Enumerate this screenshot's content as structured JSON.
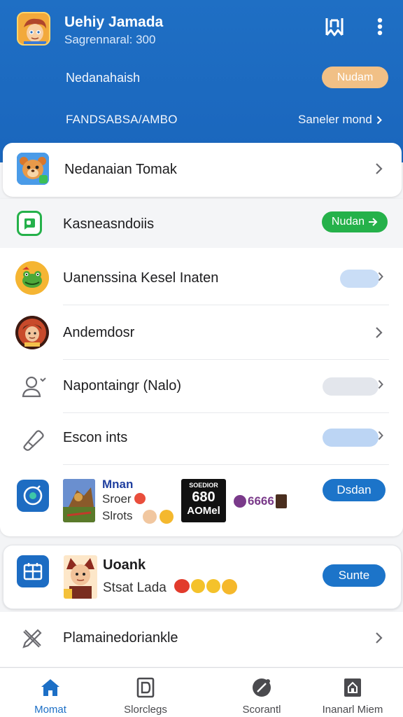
{
  "header": {
    "user_name": "Uehiy Jamada",
    "user_sub": "Sagrennaral: 300",
    "row1_text": "Nedanahaish",
    "row1_button": "Nudam",
    "row2_text": "FANDSABSA/AMBO",
    "row2_link": "Saneler mond",
    "icons": [
      "app-logo-icon",
      "more-vertical-icon"
    ]
  },
  "featured": {
    "label": "Nedanaian Tomak"
  },
  "list": {
    "band_label": "Kasneasndoiis",
    "band_button": "Nudan",
    "items": [
      {
        "label": "Uanenssina Kesel Inaten",
        "icon": "frog-avatar-icon"
      },
      {
        "label": "Andemdosr",
        "icon": "warrior-avatar-icon"
      },
      {
        "label": "Napontaingr (Nalo)",
        "icon": "users-icon"
      },
      {
        "label": "Escon ints",
        "icon": "tag-icon"
      }
    ],
    "promo": {
      "title": "Mnan",
      "line1": "Sroer",
      "line2": "Slrots",
      "badge_top": "SOEDIOR",
      "badge_mid": "680",
      "badge_bottom": "AOMel",
      "tail_text": "6666",
      "button": "Dsdan"
    }
  },
  "card3": {
    "title": "Uoank",
    "subtitle": "Stsat Lada",
    "button": "Sunte"
  },
  "plain_row": {
    "label": "Plamainedoriankle"
  },
  "bottom_nav": [
    {
      "label": "Momat",
      "icon": "home-icon",
      "active": true
    },
    {
      "label": "Slorclegs",
      "icon": "document-icon",
      "active": false
    },
    {
      "label": "Scorantl",
      "icon": "compass-icon",
      "active": false
    },
    {
      "label": "Inanarl Miem",
      "icon": "store-icon",
      "active": false
    }
  ],
  "colors": {
    "header_blue": "#1f6fc4",
    "accent_blue": "#1c74c9",
    "green": "#25b14a",
    "orange_pill": "#f1c086"
  }
}
